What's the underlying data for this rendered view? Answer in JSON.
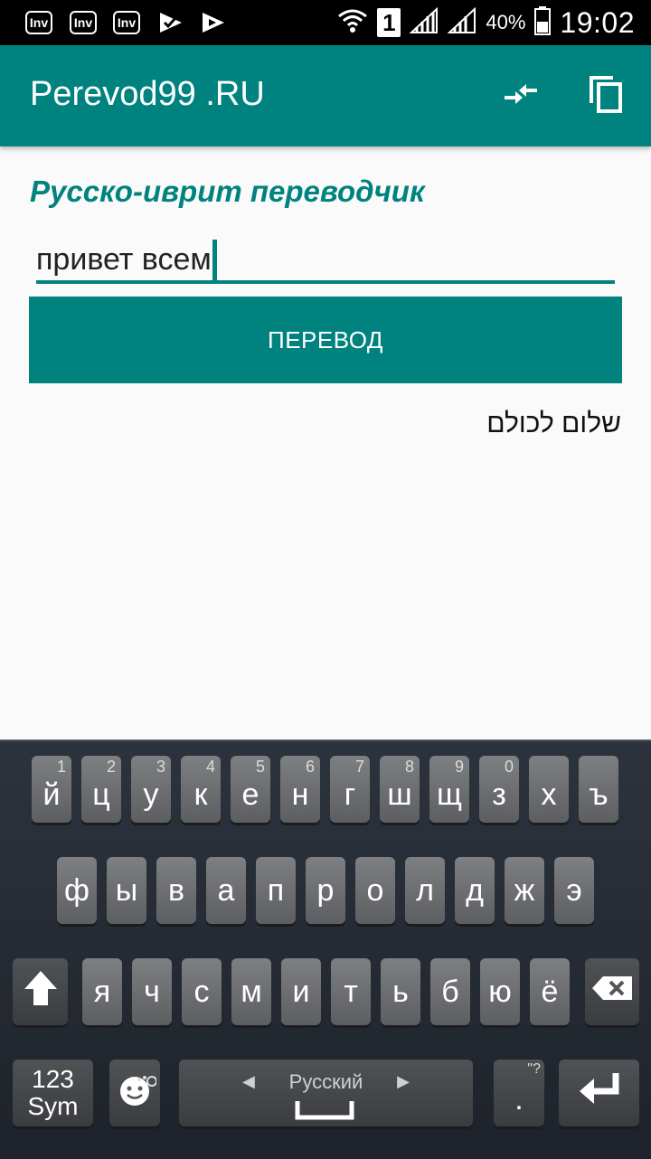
{
  "status_bar": {
    "left_icons": [
      "Inv",
      "Inv",
      "Inv"
    ],
    "signal_sim": "1",
    "battery": "40%",
    "time": "19:02"
  },
  "app_bar": {
    "title": "Perevod99 .RU",
    "swap_icon": "swap-icon",
    "copy_icon": "copy-icon"
  },
  "main": {
    "heading": "Русско-иврит переводчик",
    "input_value": "привет всем",
    "translate_button": "ПЕРЕВОД",
    "result": "שלום לכולם"
  },
  "keyboard": {
    "row1": [
      {
        "k": "й",
        "h": "1"
      },
      {
        "k": "ц",
        "h": "2"
      },
      {
        "k": "у",
        "h": "3"
      },
      {
        "k": "к",
        "h": "4"
      },
      {
        "k": "е",
        "h": "5"
      },
      {
        "k": "н",
        "h": "6"
      },
      {
        "k": "г",
        "h": "7"
      },
      {
        "k": "ш",
        "h": "8"
      },
      {
        "k": "щ",
        "h": "9"
      },
      {
        "k": "з",
        "h": "0"
      },
      {
        "k": "х",
        "h": ""
      },
      {
        "k": "ъ",
        "h": ""
      }
    ],
    "row2": [
      "ф",
      "ы",
      "в",
      "а",
      "п",
      "р",
      "о",
      "л",
      "д",
      "ж",
      "э"
    ],
    "row3": [
      "я",
      "ч",
      "с",
      "м",
      "и",
      "т",
      "ь",
      "б",
      "ю",
      "ё"
    ],
    "sym_label_line1": "123",
    "sym_label_line2": "Sym",
    "space_label": "Русский",
    "period_label": ".",
    "period_hint": "\"?"
  }
}
